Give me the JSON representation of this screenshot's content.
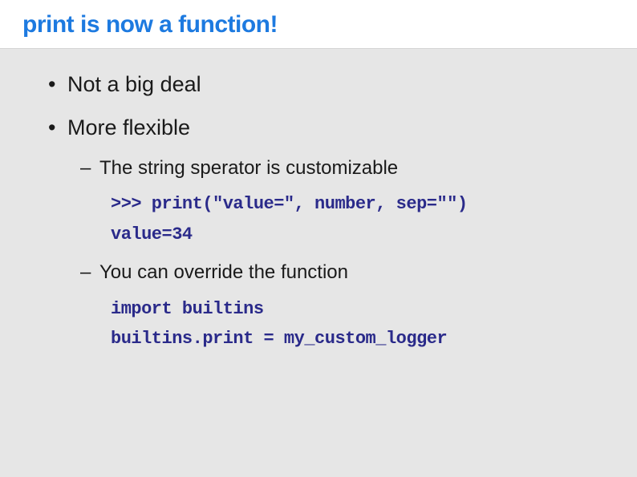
{
  "slide": {
    "title": "print is now a function!",
    "bullets": [
      {
        "text": "Not a big deal"
      },
      {
        "text": "More flexible",
        "sub": [
          {
            "text": "The string sperator is customizable",
            "code": ">>> print(\"value=\", number, sep=\"\")\nvalue=34"
          },
          {
            "text": "You can override the function",
            "code": "import builtins\nbuiltins.print = my_custom_logger"
          }
        ]
      }
    ]
  }
}
